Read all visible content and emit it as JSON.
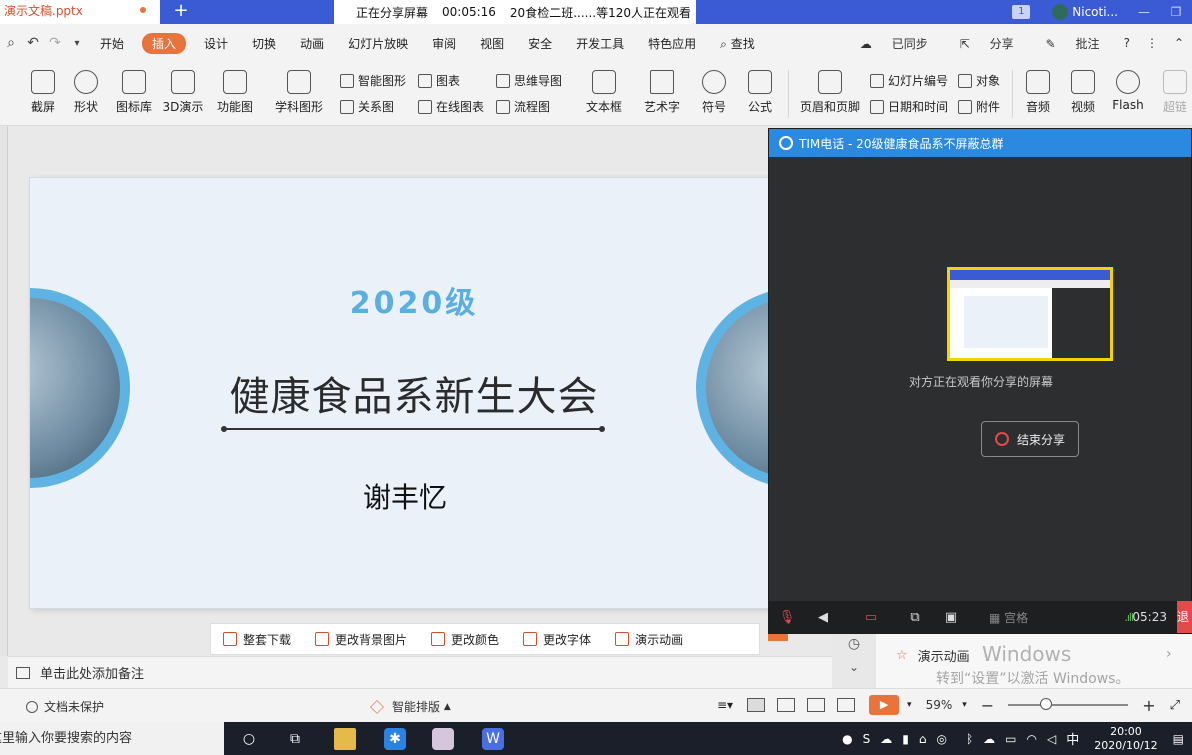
{
  "titlebar": {
    "doc_tab": "演示文稿.pptx",
    "share_status": "正在分享屏幕",
    "share_timer": "00:05:16",
    "share_viewers": "20食检二班......等120人正在观看",
    "page_badge": "1",
    "user_name": "Nicoti..."
  },
  "menu": {
    "items": [
      "开始",
      "插入",
      "设计",
      "切换",
      "动画",
      "幻灯片放映",
      "审阅",
      "视图",
      "安全",
      "开发工具",
      "特色应用"
    ],
    "active": "插入",
    "search_label": "查找",
    "synced": "已同步",
    "share": "分享",
    "comment": "批注"
  },
  "ribbon": {
    "screenshot": "截屏",
    "shape": "形状",
    "icon_lib": "图标库",
    "demo3d": "3D演示",
    "func_chart": "功能图",
    "sci_shape": "学科图形",
    "smart_shape": "智能图形",
    "relation": "关系图",
    "chart": "图表",
    "online_chart": "在线图表",
    "mindmap": "思维导图",
    "flowchart": "流程图",
    "textbox": "文本框",
    "wordart": "艺术字",
    "symbol": "符号",
    "formula": "公式",
    "header_footer": "页眉和页脚",
    "slide_number": "幻灯片编号",
    "datetime": "日期和时间",
    "object": "对象",
    "attachment": "附件",
    "audio": "音频",
    "video": "视频",
    "flash": "Flash",
    "hyperlink": "超链"
  },
  "slide": {
    "year": "2020级",
    "title": "健康食品系新生大会",
    "name": "谢丰忆"
  },
  "slide_tools": [
    "整套下载",
    "更改背景图片",
    "更改颜色",
    "更改字体",
    "演示动画"
  ],
  "notes_placeholder": "单击此处添加备注",
  "side_panel": {
    "item": "演示动画",
    "watermark_title": "Windows",
    "watermark_sub": "转到“设置”以激活 Windows。"
  },
  "tim": {
    "title": "TIM电话 - 20级健康食品系不屏蔽总群",
    "viewing_msg": "对方正在观看你分享的屏幕",
    "end_share": "结束分享",
    "grid_label": "宫格",
    "call_time": "05:23",
    "quit_label": "退"
  },
  "statusbar": {
    "protect": "文档未保护",
    "smart_layout": "智能排版",
    "zoom": "59%"
  },
  "taskbar": {
    "search_text": "在这里输入你要搜索的内容",
    "ime": "中",
    "time": "20:00",
    "date": "2020/10/12"
  }
}
